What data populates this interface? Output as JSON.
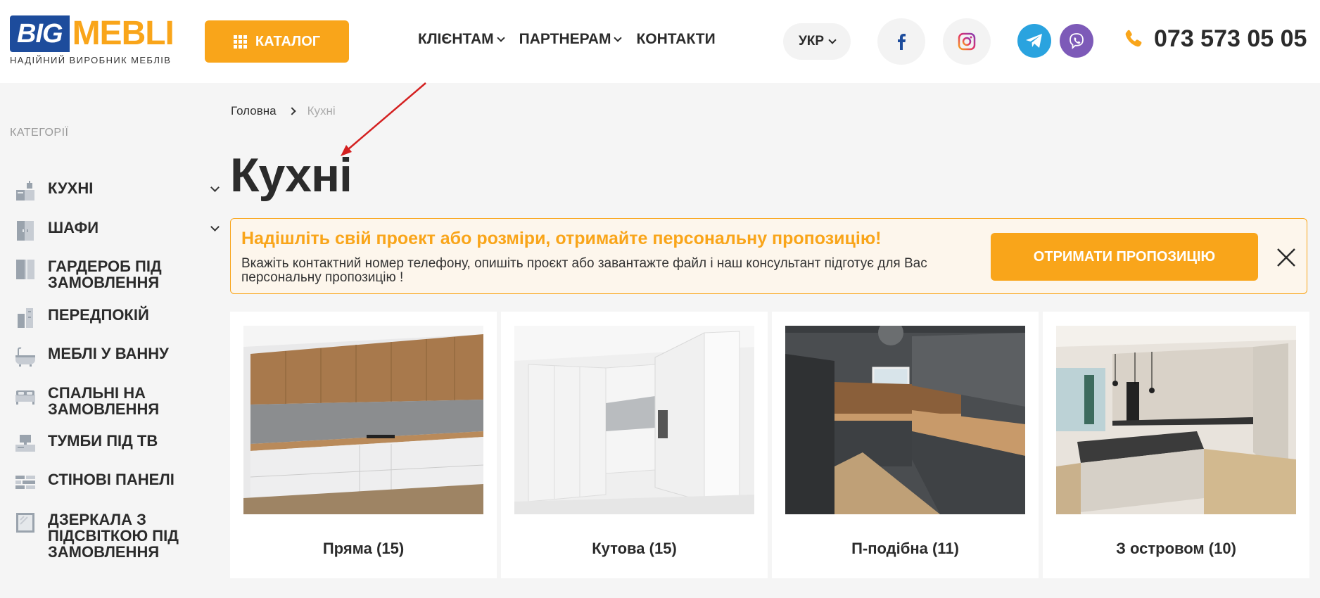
{
  "header": {
    "logo": {
      "big": "BIG",
      "mebli": "MEBLI",
      "tagline": "НАДІЙНИЙ ВИРОБНИК МЕБЛІВ"
    },
    "catalog_label": "КАТАЛОГ",
    "nav": [
      {
        "label": "КЛІЄНТАМ",
        "has_dropdown": true
      },
      {
        "label": "ПАРТНЕРАМ",
        "has_dropdown": true
      },
      {
        "label": "КОНТАКТИ",
        "has_dropdown": false
      }
    ],
    "language": "УКР",
    "social": [
      "facebook-icon",
      "instagram-icon",
      "telegram-icon",
      "viber-icon"
    ],
    "phone": "073 573 05 05"
  },
  "sidebar": {
    "title": "КАТЕГОРІЇ",
    "items": [
      {
        "label": "Кухні",
        "icon": "kitchen-icon",
        "expandable": true
      },
      {
        "label": "Шафи",
        "icon": "wardrobe-icon",
        "expandable": true
      },
      {
        "label": "Гардероб під замовлення",
        "icon": "closet-icon",
        "expandable": false
      },
      {
        "label": "Передпокій",
        "icon": "hallway-icon",
        "expandable": false
      },
      {
        "label": "Меблі у ванну",
        "icon": "bathtub-icon",
        "expandable": false
      },
      {
        "label": "Спальні на замовлення",
        "icon": "bed-icon",
        "expandable": false
      },
      {
        "label": "Тумби під ТВ",
        "icon": "tv-stand-icon",
        "expandable": false
      },
      {
        "label": "Стінові панелі",
        "icon": "wall-panel-icon",
        "expandable": false
      },
      {
        "label": "Дзеркала з підсвіткою під замовлення",
        "icon": "mirror-icon",
        "expandable": false
      }
    ]
  },
  "breadcrumb": {
    "home": "Головна",
    "current": "Кухні"
  },
  "page_title": "Кухні",
  "banner": {
    "title": "Надішліть свій проект або розміри, отримайте персональну пропозицію!",
    "text": "Вкажіть контактний номер телефону, опишіть проєкт або завантажте файл і наш консультант підготує для Вас персональну пропозицію !",
    "button": "ОТРИМАТИ ПРОПОЗИЦІЮ"
  },
  "cards": [
    {
      "name": "Пряма",
      "count": "(15)"
    },
    {
      "name": "Кутова",
      "count": "(15)"
    },
    {
      "name": "П-подібна",
      "count": "(11)"
    },
    {
      "name": "З островом",
      "count": "(10)"
    }
  ],
  "colors": {
    "accent": "#f9a51a",
    "brand_blue": "#1d4c9c",
    "telegram": "#2aa3df",
    "viber": "#7d5ab8",
    "annotation_arrow": "#d42020"
  }
}
